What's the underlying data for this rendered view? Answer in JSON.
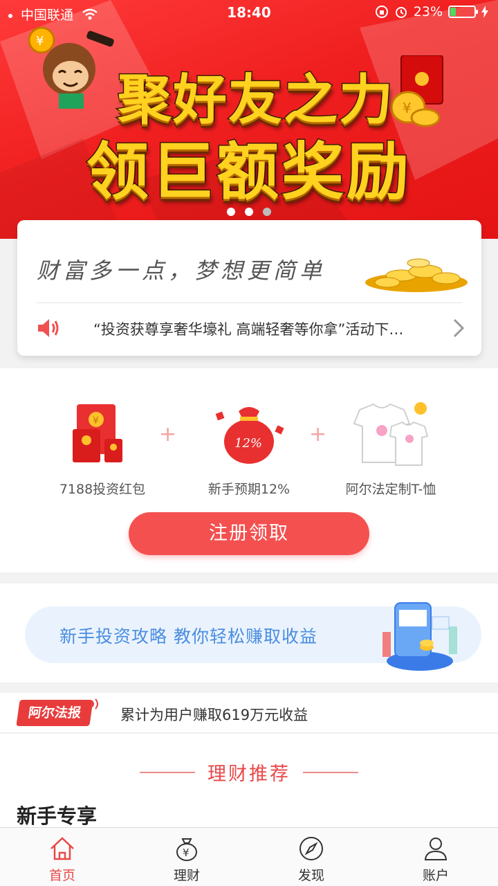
{
  "status_bar": {
    "carrier": "中国联通",
    "time": "18:40",
    "battery": "23%"
  },
  "banner": {
    "title_line1": "聚好友之力",
    "title_line2": "领巨额奖励",
    "slide_count": 3,
    "active_slide": 2
  },
  "slogan_card": {
    "slogan": "财富多一点，梦想更简单",
    "notice": "“投资获尊享奢华壕礼 高端轻奢等你拿”活动下…"
  },
  "gifts": {
    "items": [
      {
        "label": "7188投资红包",
        "icon": "red-envelope-icon",
        "badge": "¥"
      },
      {
        "label": "新手预期12%",
        "icon": "money-bag-icon",
        "badge": "12%"
      },
      {
        "label": "阿尔法定制T-恤",
        "icon": "tshirt-icon"
      }
    ],
    "register_button": "注册领取"
  },
  "strategy": {
    "banner_text": "新手投资攻略  教你轻松赚取收益"
  },
  "news": {
    "tag": "阿尔法报",
    "text": "累计为用户赚取619万元收益"
  },
  "recommend": {
    "heading": "理财推荐",
    "section_title": "新手专享"
  },
  "tabbar": {
    "tabs": [
      {
        "label": "首页",
        "icon": "home-icon",
        "active": true
      },
      {
        "label": "理财",
        "icon": "money-bag-icon",
        "active": false
      },
      {
        "label": "发现",
        "icon": "compass-icon",
        "active": false
      },
      {
        "label": "账户",
        "icon": "user-icon",
        "active": false
      }
    ]
  },
  "colors": {
    "brand_red": "#f55050",
    "banner_red": "#f01f1f",
    "link_blue": "#4a8de0",
    "title_yellow": "#ffd21f"
  }
}
